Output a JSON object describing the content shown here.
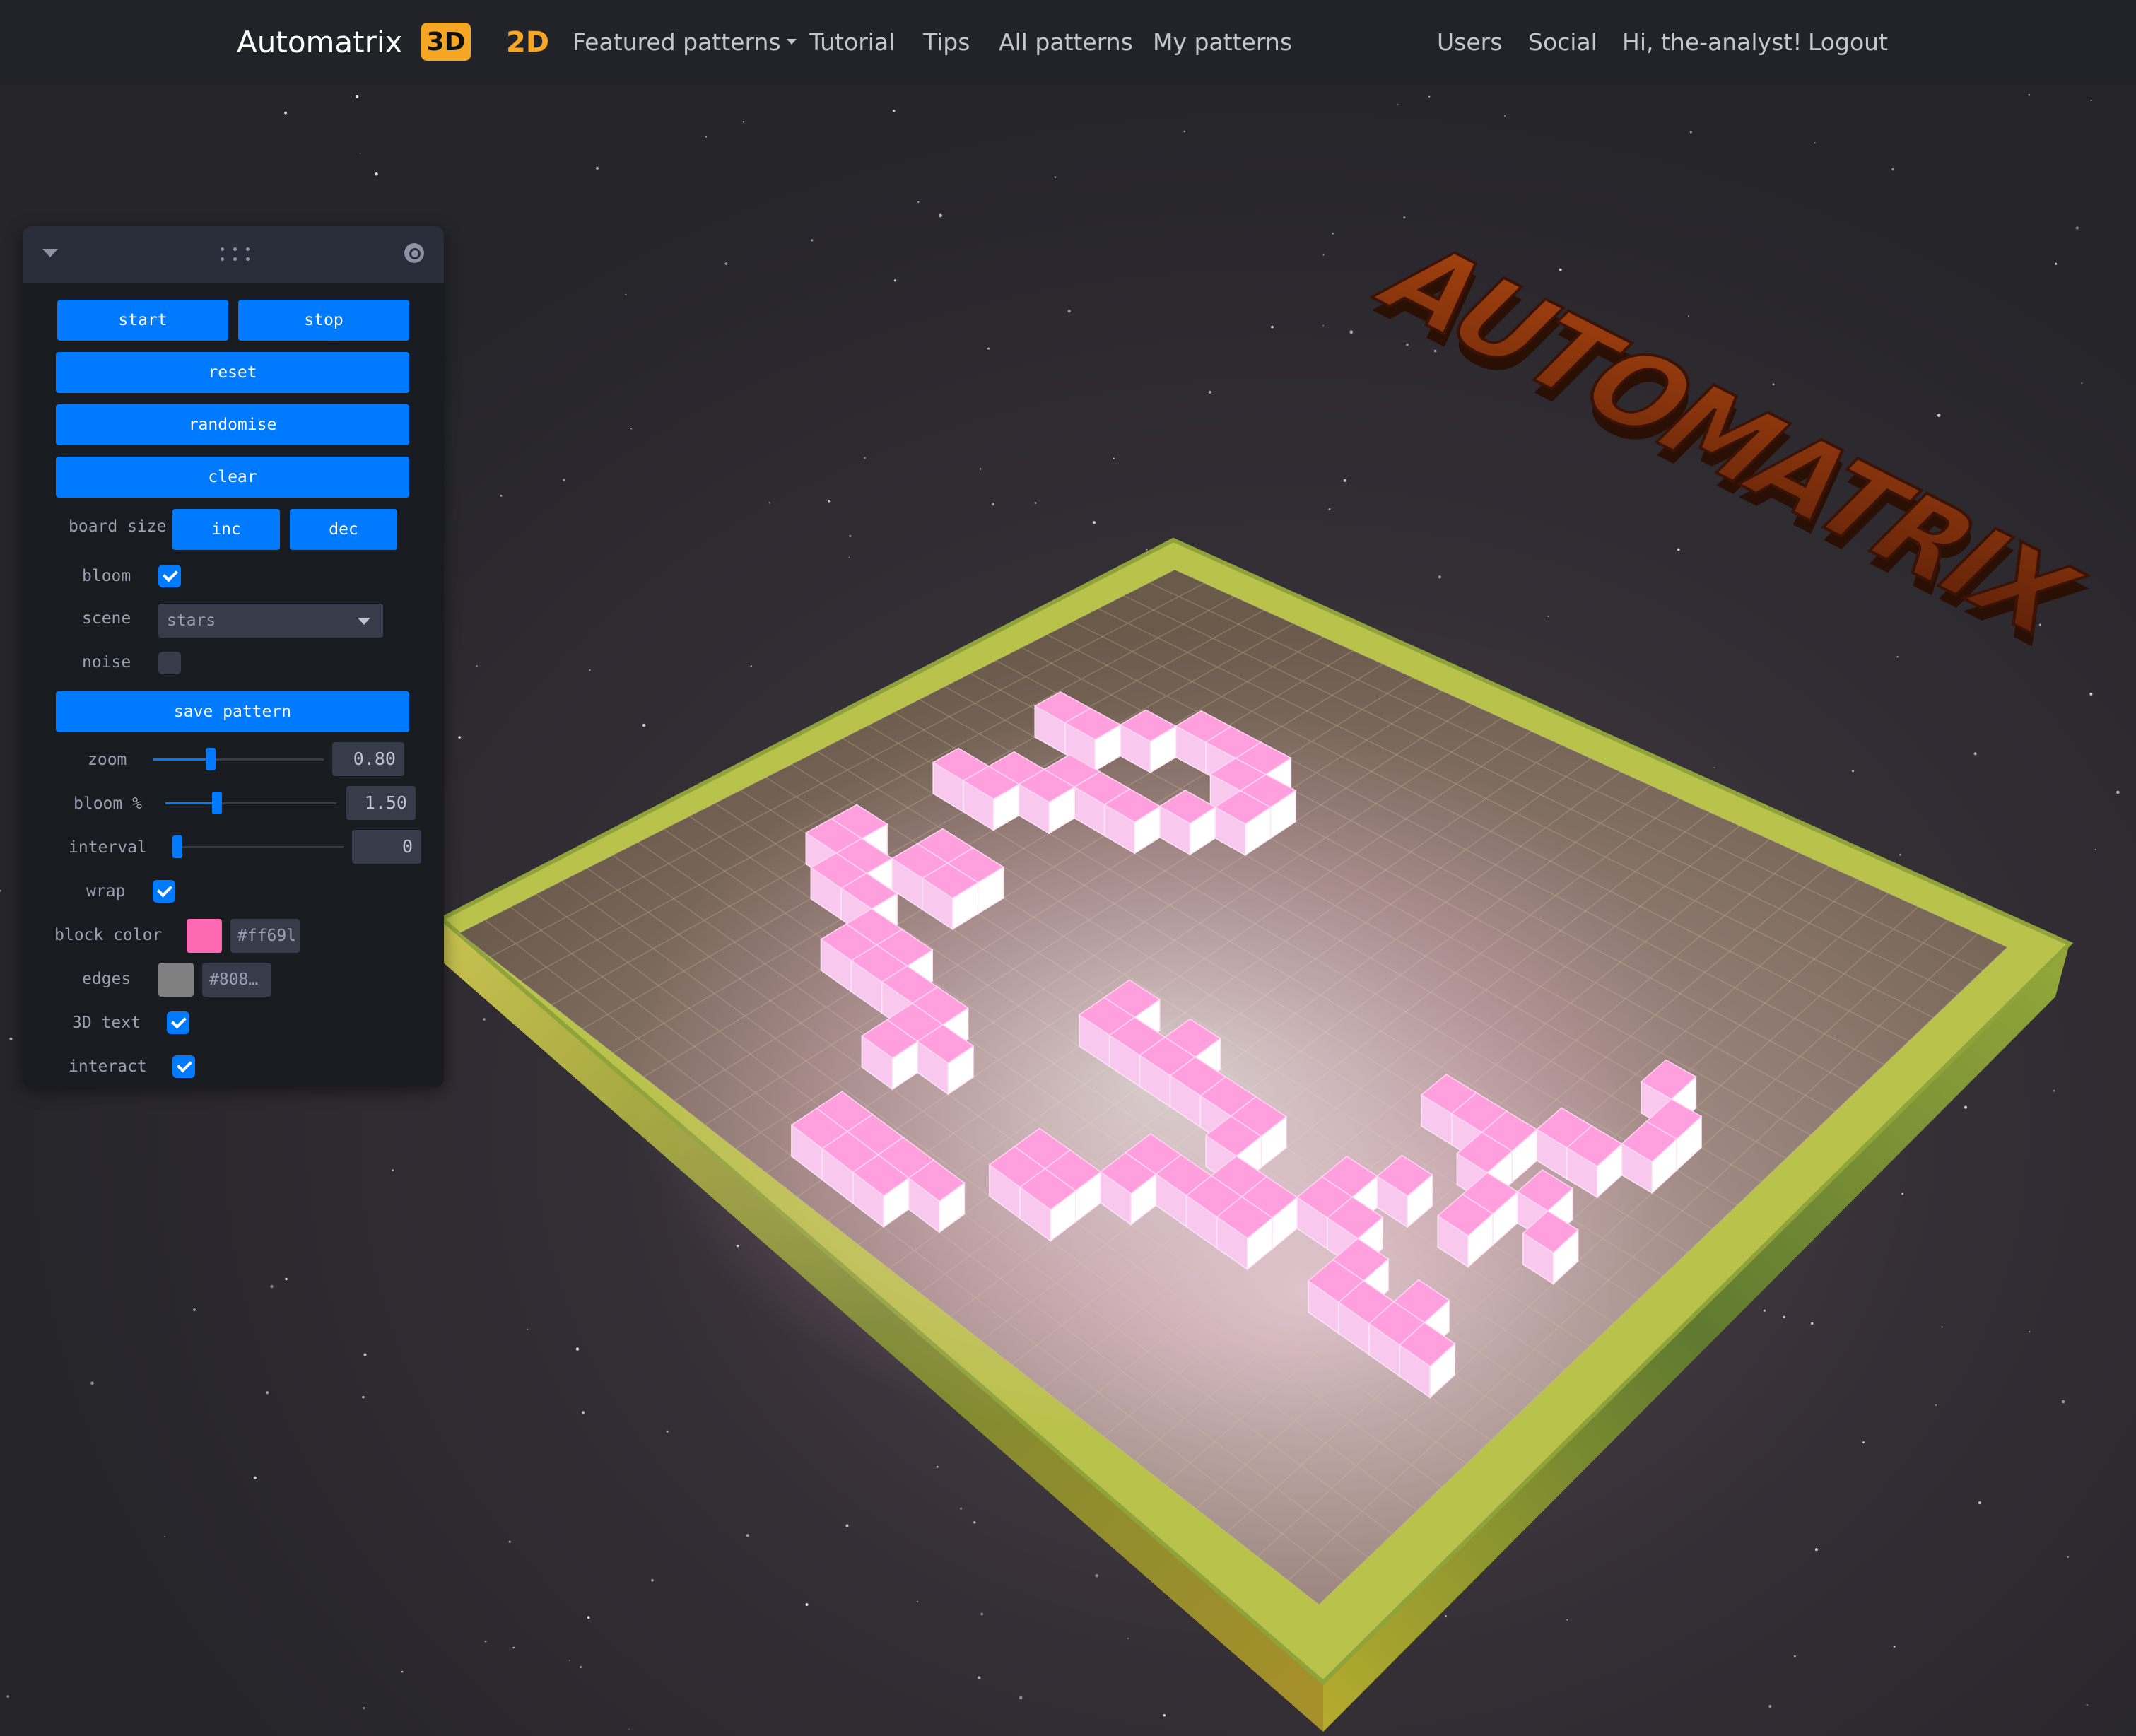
{
  "nav": {
    "brand": "Automatrix",
    "badge_3d": "3D",
    "link_2d": "2D",
    "featured": "Featured patterns",
    "tutorial": "Tutorial",
    "tips": "Tips",
    "all_patterns": "All patterns",
    "my_patterns": "My patterns",
    "users": "Users",
    "social": "Social",
    "greeting": "Hi, the-analyst!",
    "logout": "Logout"
  },
  "panel": {
    "start": "start",
    "stop": "stop",
    "reset": "reset",
    "randomise": "randomise",
    "clear": "clear",
    "board_size_label": "board size",
    "inc": "inc",
    "dec": "dec",
    "bloom_label": "bloom",
    "bloom_checked": true,
    "scene_label": "scene",
    "scene_value": "stars",
    "noise_label": "noise",
    "noise_checked": false,
    "save_pattern": "save pattern",
    "zoom_label": "zoom",
    "zoom_value": "0.80",
    "zoom_fraction": 0.33,
    "bloom_pct_label": "bloom %",
    "bloom_pct_value": "1.50",
    "bloom_pct_fraction": 0.29,
    "interval_label": "interval",
    "interval_value": "0",
    "interval_fraction": 0.0,
    "wrap_label": "wrap",
    "wrap_checked": true,
    "block_color_label": "block color",
    "block_color_value": "#ff69l",
    "block_color": "#ff69b4",
    "edges_label": "edges",
    "edges_value": "#808…",
    "edges_color": "#808080",
    "text3d_label": "3D text",
    "text3d_checked": true,
    "interact_label": "interact",
    "interact_checked": true
  },
  "scene": {
    "title_3d": "AUTOMATRIX",
    "board_frame_color": "#9fae3c",
    "cube_color": "#ff8fd6",
    "background": "#26262b"
  },
  "icons": [
    "collapse-chevron-icon",
    "drag-handle-icon",
    "search-icon",
    "dropdown-caret-icon",
    "checkmark-icon"
  ]
}
